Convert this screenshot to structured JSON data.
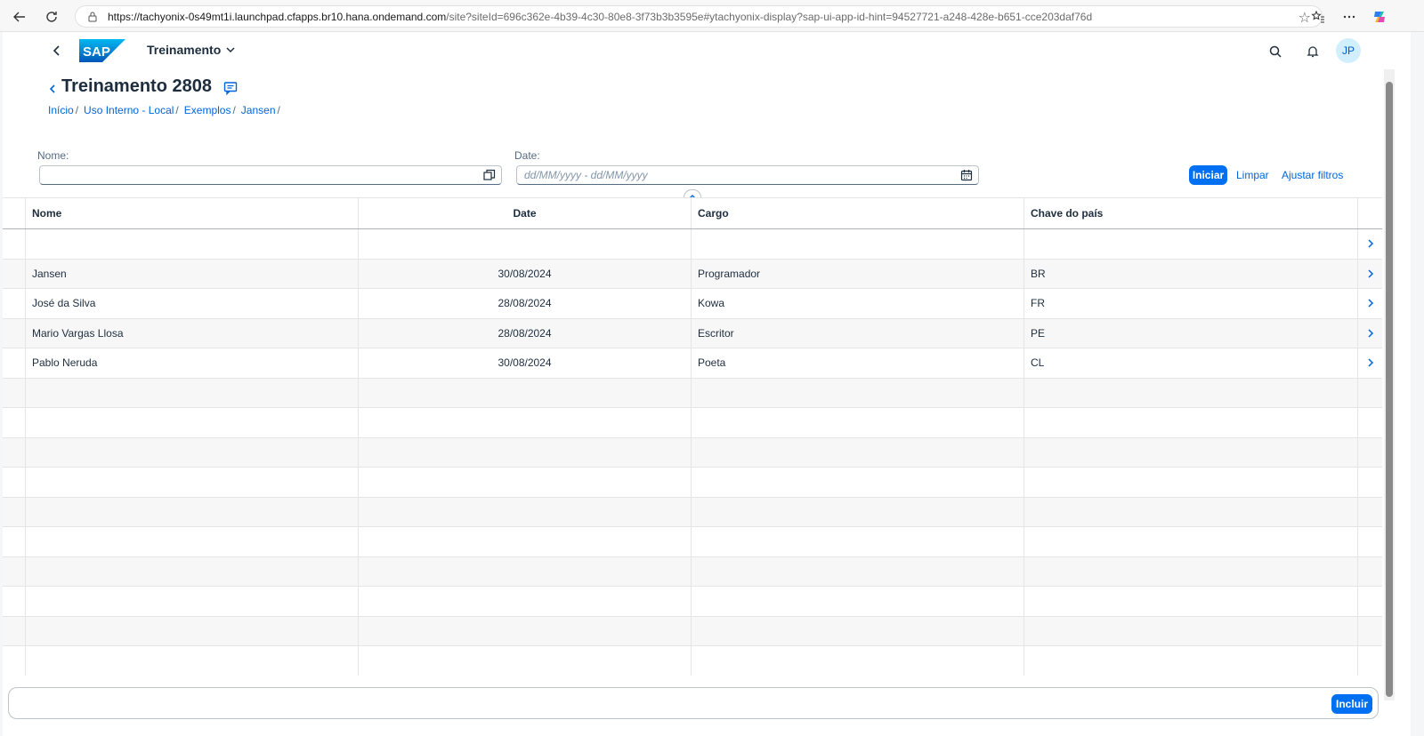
{
  "browser": {
    "url_host": "https://tachyonix-0s49mt1i.launchpad.cfapps.br10.hana.ondemand.com",
    "url_path": "/site?siteId=696c362e-4b39-4c30-80e8-3f73b3b3595e#ytachyonix-display?sap-ui-app-id-hint=94527721-a248-428e-b651-cce203daf76d"
  },
  "shell": {
    "app_title": "Treinamento",
    "avatar_initials": "JP",
    "accent": "#0070f2"
  },
  "header": {
    "title": "Treinamento 2808",
    "breadcrumbs": [
      "Início",
      "Uso Interno - Local",
      "Exemplos",
      "Jansen"
    ],
    "separator": "/"
  },
  "filters": {
    "name_label": "Nome:",
    "date_label": "Date:",
    "date_placeholder": "dd/MM/yyyy - dd/MM/yyyy",
    "go_label": "Iniciar",
    "clear_label": "Limpar",
    "adapt_label": "Ajustar filtros"
  },
  "table": {
    "columns": [
      "Nome",
      "Date",
      "Cargo",
      "Chave do país"
    ],
    "rows": [
      {
        "nome": "",
        "date": "",
        "cargo": "",
        "pais": "",
        "nav": true
      },
      {
        "nome": "Jansen",
        "date": "30/08/2024",
        "cargo": "Programador",
        "pais": "BR",
        "nav": true
      },
      {
        "nome": "José da Silva",
        "date": "28/08/2024",
        "cargo": "Kowa",
        "pais": "FR",
        "nav": true
      },
      {
        "nome": "Mario Vargas Llosa",
        "date": "28/08/2024",
        "cargo": "Escritor",
        "pais": "PE",
        "nav": true
      },
      {
        "nome": "Pablo Neruda",
        "date": "30/08/2024",
        "cargo": "Poeta",
        "pais": "CL",
        "nav": true
      }
    ]
  },
  "footer": {
    "add_label": "Incluir"
  }
}
